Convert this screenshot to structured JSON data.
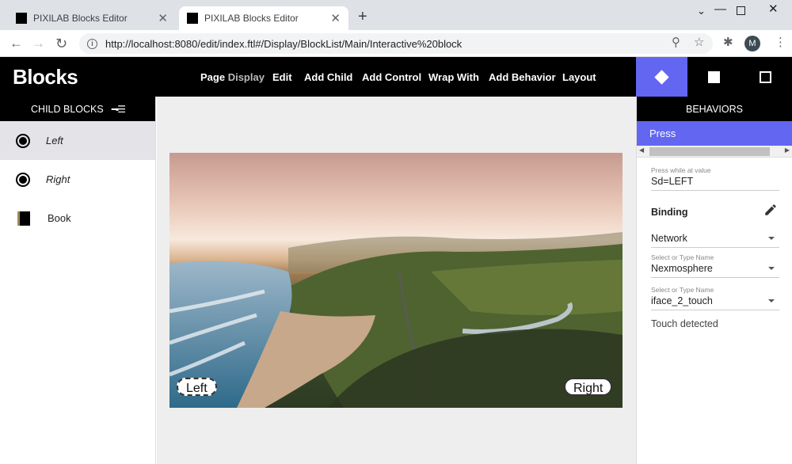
{
  "browser": {
    "tabs": [
      {
        "title": "PIXILAB Blocks Editor",
        "active": false
      },
      {
        "title": "PIXILAB Blocks Editor",
        "active": true
      }
    ],
    "url": "http://localhost:8080/edit/index.ftl#/Display/BlockList/Main/Interactive%20block",
    "profile_initial": "M"
  },
  "app": {
    "logo": "Blocks",
    "menu": {
      "page_label": "Page",
      "page_context": "Display",
      "edit": "Edit",
      "add_child": "Add Child",
      "add_control": "Add Control",
      "wrap_with": "Wrap With",
      "add_behavior": "Add Behavior",
      "layout": "Layout"
    },
    "accent_color": "#6366f1"
  },
  "left_panel": {
    "header": "CHILD BLOCKS",
    "items": [
      {
        "label": "Left",
        "icon": "radio-icon",
        "selected": true
      },
      {
        "label": "Right",
        "icon": "radio-icon",
        "selected": false
      },
      {
        "label": "Book",
        "icon": "book-icon",
        "selected": false
      }
    ]
  },
  "canvas": {
    "buttons": {
      "left": "Left",
      "right": "Right"
    }
  },
  "right_panel": {
    "header": "BEHAVIORS",
    "behavior": "Press",
    "press_label": "Press while at value",
    "press_value": "Sd=LEFT",
    "binding_title": "Binding",
    "source": {
      "value": "Network"
    },
    "name1": {
      "label": "Select or Type Name",
      "value": "Nexmosphere"
    },
    "name2": {
      "label": "Select or Type Name",
      "value": "iface_2_touch"
    },
    "touch": "Touch detected"
  }
}
